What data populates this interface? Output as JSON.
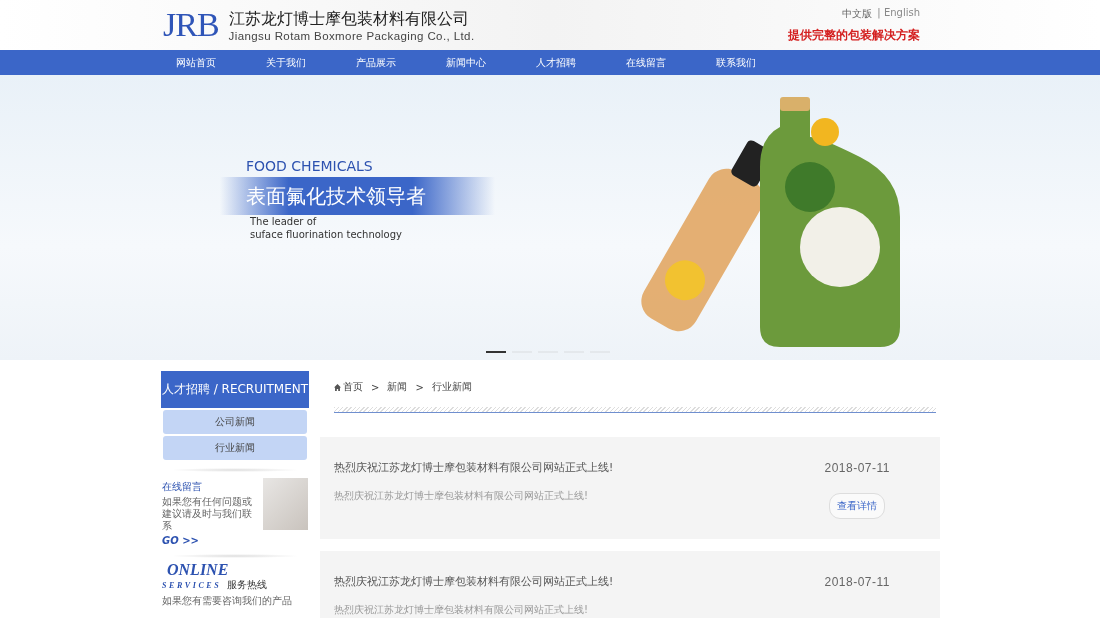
{
  "header": {
    "logo": "JRB",
    "company_cn": "江苏龙灯博士摩包装材料有限公司",
    "company_en": "Jiangsu Rotam Boxmore Packaging Co., Ltd.",
    "languages": [
      {
        "label": "中文版",
        "selected": true
      },
      {
        "label": "| English",
        "selected": false
      }
    ],
    "slogan": "提供完整的包装解决方案"
  },
  "nav": [
    {
      "label": "网站首页",
      "selected": false
    },
    {
      "label": "关于我们",
      "selected": false
    },
    {
      "label": "产品展示",
      "selected": false
    },
    {
      "label": "新闻中心",
      "selected": false
    },
    {
      "label": "人才招聘",
      "selected": false
    },
    {
      "label": "在线留言",
      "selected": false
    },
    {
      "label": "联系我们",
      "selected": false
    }
  ],
  "banner": {
    "kicker": "FOOD CHEMICALS",
    "headline": "表面氟化技术领导者",
    "subtitle_lines": [
      "The leader of",
      "suface fluorination technology"
    ],
    "dots": [
      {
        "selected": true
      },
      {
        "selected": false
      },
      {
        "selected": false
      },
      {
        "selected": false
      },
      {
        "selected": false
      }
    ]
  },
  "sidebar": {
    "title": "人才招聘 / RECRUITMENT",
    "items": [
      {
        "label": "公司新闻"
      },
      {
        "label": "行业新闻"
      }
    ],
    "message": {
      "title": "在线留言",
      "text": "如果您有任何问题或建议请及时与我们联系",
      "link": "GO >>"
    },
    "services": {
      "word1": "ONLINE",
      "word2": "SERVICES",
      "hotline": "服务热线",
      "text": "如果您有需要咨询我们的产品"
    }
  },
  "breadcrumb": [
    "首页",
    ">",
    "新闻",
    ">",
    "行业新闻"
  ],
  "articles": [
    {
      "title": "热烈庆祝江苏龙灯博士摩包装材料有限公司网站正式上线!",
      "date": "2018-07-11",
      "summary": "热烈庆祝江苏龙灯博士摩包装材料有限公司网站正式上线!",
      "button": "查看详情"
    },
    {
      "title": "热烈庆祝江苏龙灯博士摩包装材料有限公司网站正式上线!",
      "date": "2018-07-11",
      "summary": "热烈庆祝江苏龙灯博士摩包装材料有限公司网站正式上线!"
    }
  ]
}
